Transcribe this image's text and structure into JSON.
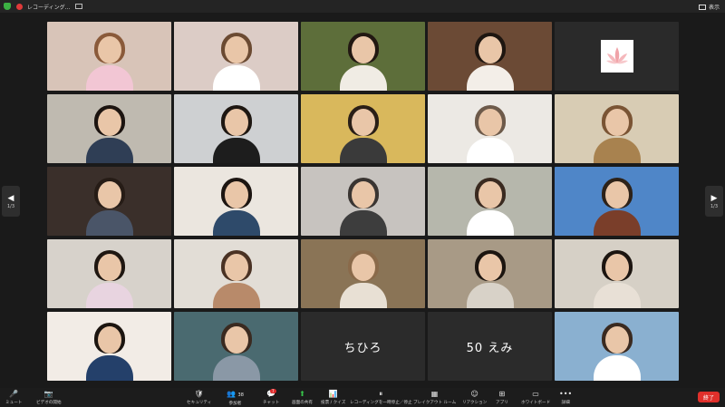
{
  "window": {
    "title": "レコーディング...",
    "view_label": "表示"
  },
  "pager": {
    "left_count": "1/3",
    "right_count": "1/3"
  },
  "tiles": [
    {
      "bg": "#d8c4b8",
      "hair": "#8a5a3a",
      "body": "#f2c6d4"
    },
    {
      "bg": "#dcccc6",
      "hair": "#6b4a32",
      "body": "#ffffff",
      "speaking": true
    },
    {
      "bg": "#5d6e3a",
      "hair": "#221812",
      "body": "#f0ece4"
    },
    {
      "bg": "#6b4a35",
      "hair": "#1e1610",
      "body": "#f3eee8"
    },
    {
      "lotus": true
    },
    {
      "bg": "#bfbab0",
      "hair": "#1c1410",
      "body": "#2f3e55"
    },
    {
      "bg": "#ced0d2",
      "hair": "#1e1712",
      "body": "#1d1d1d"
    },
    {
      "bg": "#d9b85c",
      "hair": "#2a1f17",
      "body": "#3a3a3a"
    },
    {
      "bg": "#ece9e4",
      "hair": "#6d5a4a",
      "body": "#ffffff"
    },
    {
      "bg": "#d8ccb4",
      "hair": "#7a5434",
      "body": "#a8824f"
    },
    {
      "bg": "#3a2f2a",
      "hair": "#261c16",
      "body": "#4a5568"
    },
    {
      "bg": "#ebe6df",
      "hair": "#1c1511",
      "body": "#2e4a6a"
    },
    {
      "bg": "#c7c3bf",
      "hair": "#3a3532",
      "body": "#3d3d3d"
    },
    {
      "bg": "#b6b7ac",
      "hair": "#3a2a20",
      "body": "#ffffff"
    },
    {
      "bg": "#4f86c8",
      "hair": "#2d2219",
      "body": "#7a3e2a"
    },
    {
      "bg": "#d7d2cb",
      "hair": "#1f1711",
      "body": "#e8d4e0"
    },
    {
      "bg": "#e2ddd6",
      "hair": "#4a3224",
      "body": "#b88a6a"
    },
    {
      "bg": "#8a7456",
      "hair": "#8a6a4a",
      "body": "#e8e0d4"
    },
    {
      "bg": "#a89a86",
      "hair": "#1c1510",
      "body": "#d8d2c8"
    },
    {
      "bg": "#d6d0c6",
      "hair": "#1c1510",
      "body": "#e8e0d6"
    },
    {
      "bg": "#f2ece6",
      "hair": "#1c1510",
      "body": "#24406a"
    },
    {
      "bg": "#4a6a70",
      "hair": "#3a2a20",
      "body": "#8a98a6"
    },
    {
      "name": "ちひろ"
    },
    {
      "name": "50 えみ"
    },
    {
      "bg": "#8ab0d0",
      "hair": "#3a2a20",
      "body": "#ffffff"
    }
  ],
  "toolbar": {
    "mute": {
      "icon": "🎤",
      "label": "ミュート"
    },
    "video": {
      "icon": "📷",
      "label": "ビデオの開始"
    },
    "security": {
      "icon": "🛡",
      "label": "セキュリティ"
    },
    "participants": {
      "icon": "👥",
      "label": "参加者",
      "count": "38"
    },
    "chat": {
      "icon": "💬",
      "label": "チャット",
      "badge": "7"
    },
    "share": {
      "icon": "⬆",
      "label": "画面の共有"
    },
    "polls": {
      "icon": "📊",
      "label": "投票 / クイズ"
    },
    "record": {
      "icon": "⏸",
      "label": "レコーディングを一時停止／停止"
    },
    "breakout": {
      "icon": "▦",
      "label": "ブレイクアウト ルーム"
    },
    "reactions": {
      "icon": "☺",
      "label": "リアクション"
    },
    "apps": {
      "icon": "⊞",
      "label": "アプリ"
    },
    "whiteboard": {
      "icon": "▭",
      "label": "ホワイトボード"
    },
    "more": {
      "icon": "•••",
      "label": "詳細"
    },
    "end_label": "終了"
  }
}
